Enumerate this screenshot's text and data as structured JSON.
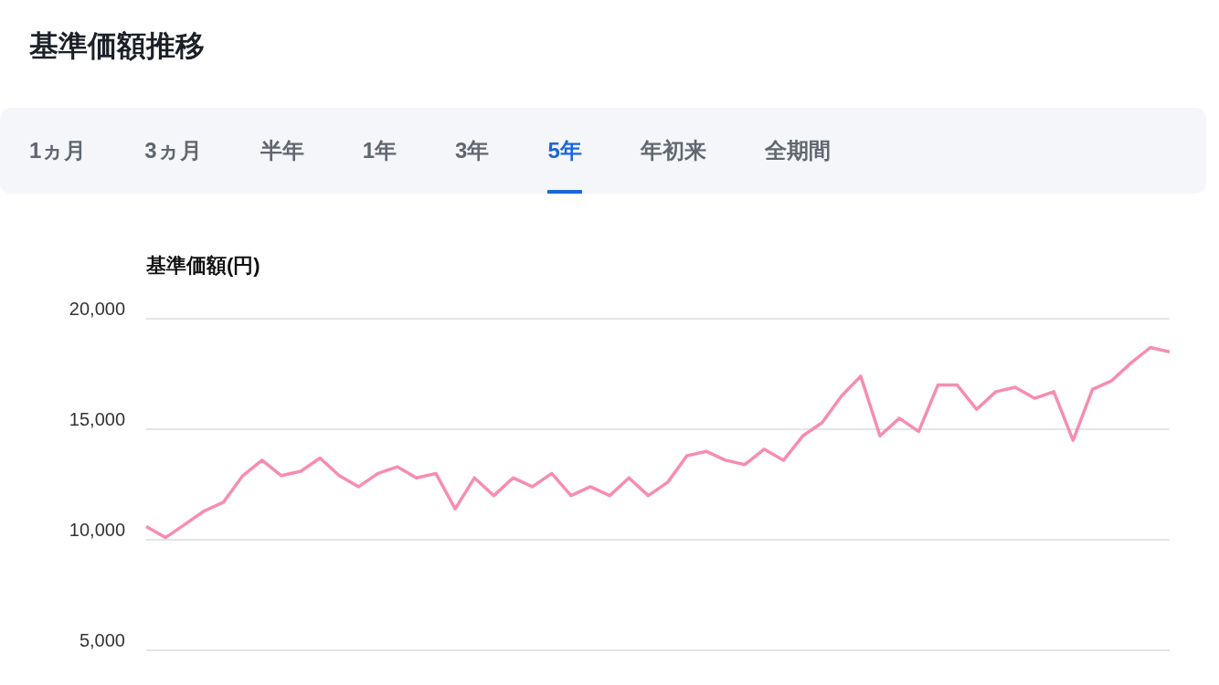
{
  "title": "基準価額推移",
  "tabs": [
    {
      "label": "1ヵ月",
      "selected": false
    },
    {
      "label": "3ヵ月",
      "selected": false
    },
    {
      "label": "半年",
      "selected": false
    },
    {
      "label": "1年",
      "selected": false
    },
    {
      "label": "3年",
      "selected": false
    },
    {
      "label": "5年",
      "selected": true
    },
    {
      "label": "年初来",
      "selected": false
    },
    {
      "label": "全期間",
      "selected": false
    }
  ],
  "chart": {
    "chart_data": {
      "type": "line",
      "ylabel": "基準価額(円)",
      "yticks": [
        {
          "value": 5000,
          "label": "5,000"
        },
        {
          "value": 10000,
          "label": "10,000"
        },
        {
          "value": 15000,
          "label": "15,000"
        },
        {
          "value": 20000,
          "label": "20,000"
        }
      ],
      "ylim": [
        5000,
        20000
      ],
      "series": [
        {
          "color": "#f78db0",
          "values": [
            10600,
            10100,
            10700,
            11300,
            11700,
            12900,
            13600,
            12900,
            13100,
            13700,
            12900,
            12400,
            13000,
            13300,
            12800,
            13000,
            11400,
            12800,
            12000,
            12800,
            12400,
            13000,
            12000,
            12400,
            12000,
            12800,
            12000,
            12600,
            13800,
            14000,
            13600,
            13400,
            14100,
            13600,
            14700,
            15300,
            16500,
            17400,
            14700,
            15500,
            14900,
            17000,
            17000,
            15900,
            16700,
            16900,
            16400,
            16700,
            14500,
            16800,
            17200,
            18000,
            18700,
            18500
          ]
        }
      ]
    }
  }
}
